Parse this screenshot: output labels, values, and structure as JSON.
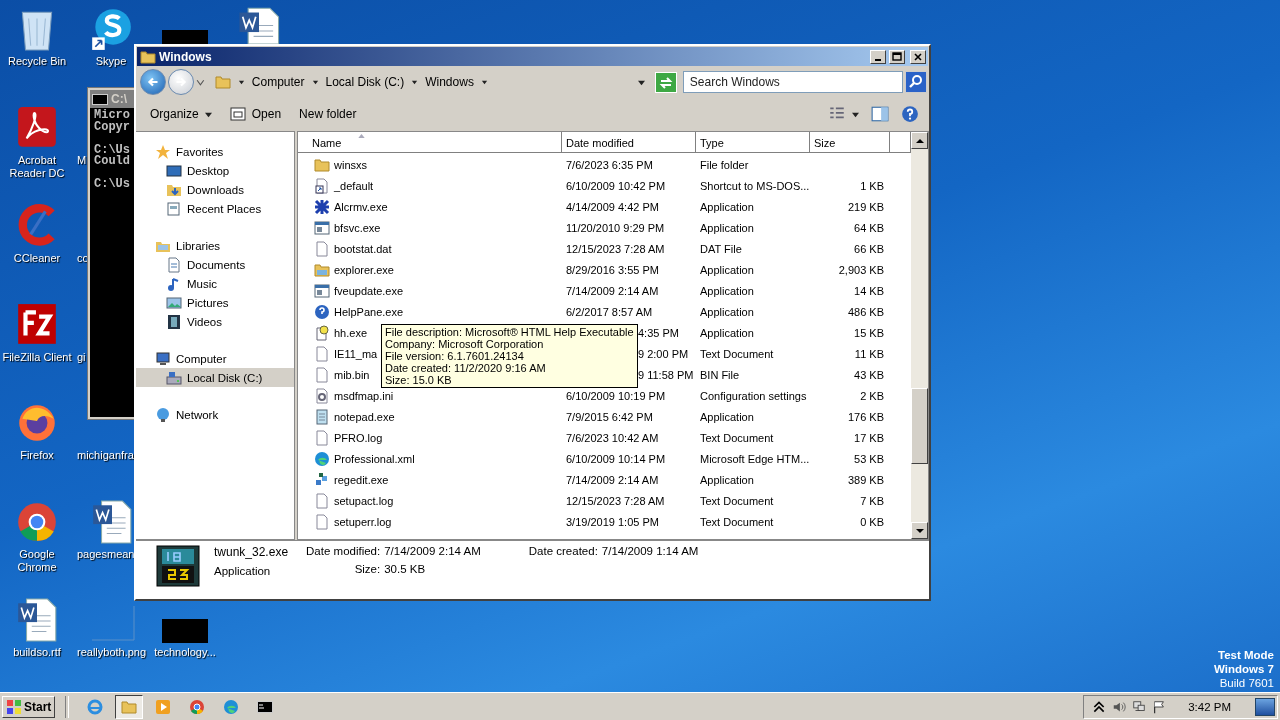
{
  "desktop_icons": [
    {
      "kind": "recycle",
      "label": "Recycle Bin"
    },
    {
      "kind": "skype",
      "label": "Skype"
    },
    {
      "kind": "redacted"
    },
    {
      "kind": "word"
    },
    {
      "kind": "acrobat",
      "label": "Acrobat Reader DC"
    },
    {
      "kind": "none",
      "label": "Mi"
    },
    {
      "kind": "ccleaner",
      "label": "CCleaner"
    },
    {
      "kind": "none",
      "label": "co"
    },
    {
      "kind": "filezilla",
      "label": "FileZilla Client"
    },
    {
      "kind": "none",
      "label": "gi"
    },
    {
      "kind": "firefox",
      "label": "Firefox"
    },
    {
      "kind": "none",
      "label": "michiganfra"
    },
    {
      "kind": "chrome",
      "label": "Google Chrome"
    },
    {
      "kind": "word",
      "label": "pagesmean"
    },
    {
      "kind": "word",
      "label": "buildso.rtf"
    },
    {
      "kind": "blank",
      "label": "reallyboth.png"
    },
    {
      "kind": "redacted",
      "label": "technology..."
    }
  ],
  "console_window": {
    "title": "C:\\",
    "blocks": [
      [
        "Micro",
        "Copyr"
      ],
      [
        "C:\\Us",
        "Could"
      ],
      [
        "C:\\Us"
      ]
    ]
  },
  "explorer": {
    "title": "Windows",
    "breadcrumb": [
      "Computer",
      "Local Disk (C:)",
      "Windows"
    ],
    "search": {
      "placeholder": "Search Windows"
    },
    "toolbar": [
      "Organize",
      "Open",
      "New folder"
    ],
    "nav": [
      {
        "label": "Favorites",
        "kind": "star",
        "selected": false,
        "children": [
          {
            "label": "Desktop",
            "kind": "desktop",
            "selected": false
          },
          {
            "label": "Downloads",
            "kind": "downloads",
            "selected": false
          },
          {
            "label": "Recent Places",
            "kind": "recent",
            "selected": false
          }
        ]
      },
      {
        "label": "Libraries",
        "kind": "library",
        "selected": false,
        "children": [
          {
            "label": "Documents",
            "kind": "document",
            "selected": false
          },
          {
            "label": "Music",
            "kind": "music",
            "selected": false
          },
          {
            "label": "Pictures",
            "kind": "pictures",
            "selected": false
          },
          {
            "label": "Videos",
            "kind": "videos",
            "selected": false
          }
        ]
      },
      {
        "label": "Computer",
        "kind": "computer",
        "selected": false,
        "children": [
          {
            "label": "Local Disk (C:)",
            "kind": "disk",
            "selected": true
          }
        ]
      },
      {
        "label": "Network",
        "kind": "network",
        "selected": false
      }
    ],
    "columns": [
      "Name",
      "Date modified",
      "Type",
      "Size"
    ],
    "rows": [
      {
        "name": "winsxs",
        "kind": "folder",
        "date": "7/6/2023 6:35 PM",
        "type": "File folder"
      },
      {
        "name": "_default",
        "kind": "shortcut",
        "date": "6/10/2009 10:42 PM",
        "type": "Shortcut to MS-DOS...",
        "size": "1 KB"
      },
      {
        "name": "Alcrmv.exe",
        "kind": "knot",
        "date": "4/14/2009 4:42 PM",
        "type": "Application",
        "size": "219 KB"
      },
      {
        "name": "bfsvc.exe",
        "kind": "app",
        "date": "11/20/2010 9:29 PM",
        "type": "Application",
        "size": "64 KB"
      },
      {
        "name": "bootstat.dat",
        "kind": "file",
        "date": "12/15/2023 7:28 AM",
        "type": "DAT File",
        "size": "66 KB"
      },
      {
        "name": "explorer.exe",
        "kind": "explorer",
        "date": "8/29/2016 3:55 PM",
        "type": "Application",
        "size": "2,903 KB"
      },
      {
        "name": "fveupdate.exe",
        "kind": "app",
        "date": "7/14/2009 2:14 AM",
        "type": "Application",
        "size": "14 KB"
      },
      {
        "name": "HelpPane.exe",
        "kind": "help",
        "date": "6/2/2017 8:57 AM",
        "type": "Application",
        "size": "486 KB"
      },
      {
        "name": "hh.exe",
        "kind": "hh",
        "date": "4:35 PM",
        "type": "Application",
        "size": "15 KB",
        "tooltip": [
          "File description: Microsoft® HTML Help Executable",
          "Company: Microsoft Corporation",
          "File version: 6.1.7601.24134",
          "Date created: 11/2/2020 9:16 AM",
          "Size: 15.0 KB"
        ]
      },
      {
        "name": "IE11_ma",
        "kind": "file",
        "date": "9 2:00 PM",
        "type": "Text Document",
        "size": "11 KB"
      },
      {
        "name": "mib.bin",
        "kind": "file",
        "date": "9 11:58 PM",
        "type": "BIN File",
        "size": "43 KB"
      },
      {
        "name": "msdfmap.ini",
        "kind": "config",
        "date": "6/10/2009 10:19 PM",
        "type": "Configuration settings",
        "size": "2 KB"
      },
      {
        "name": "notepad.exe",
        "kind": "notepad",
        "date": "7/9/2015 6:42 PM",
        "type": "Application",
        "size": "176 KB"
      },
      {
        "name": "PFRO.log",
        "kind": "file",
        "date": "7/6/2023 10:42 AM",
        "type": "Text Document",
        "size": "17 KB"
      },
      {
        "name": "Professional.xml",
        "kind": "edge",
        "date": "6/10/2009 10:14 PM",
        "type": "Microsoft Edge HTM...",
        "size": "53 KB"
      },
      {
        "name": "regedit.exe",
        "kind": "regedit",
        "date": "7/14/2009 2:14 AM",
        "type": "Application",
        "size": "389 KB"
      },
      {
        "name": "setupact.log",
        "kind": "file",
        "date": "12/15/2023 7:28 AM",
        "type": "Text Document",
        "size": "7 KB"
      },
      {
        "name": "setuperr.log",
        "kind": "file",
        "date": "3/19/2019 1:05 PM",
        "type": "Text Document",
        "size": "0 KB"
      }
    ],
    "details": {
      "name": "twunk_32.exe",
      "type": "Application",
      "modified_label": "Date modified:",
      "modified": "7/14/2009 2:14 AM",
      "size_label": "Size:",
      "size": "30.5 KB",
      "created_label": "Date created:",
      "created": "7/14/2009 1:14 AM"
    }
  },
  "taskbar": {
    "start": "Start",
    "apps": [
      {
        "kind": "ie",
        "selected": false
      },
      {
        "kind": "explorer",
        "selected": true
      },
      {
        "kind": "media",
        "selected": false
      },
      {
        "kind": "chrome",
        "selected": false
      },
      {
        "kind": "edge",
        "selected": false
      },
      {
        "kind": "console",
        "selected": false
      }
    ],
    "clock": "3:42 PM"
  },
  "system_notice": [
    "Test Mode",
    "Windows 7",
    "Build 7601"
  ]
}
